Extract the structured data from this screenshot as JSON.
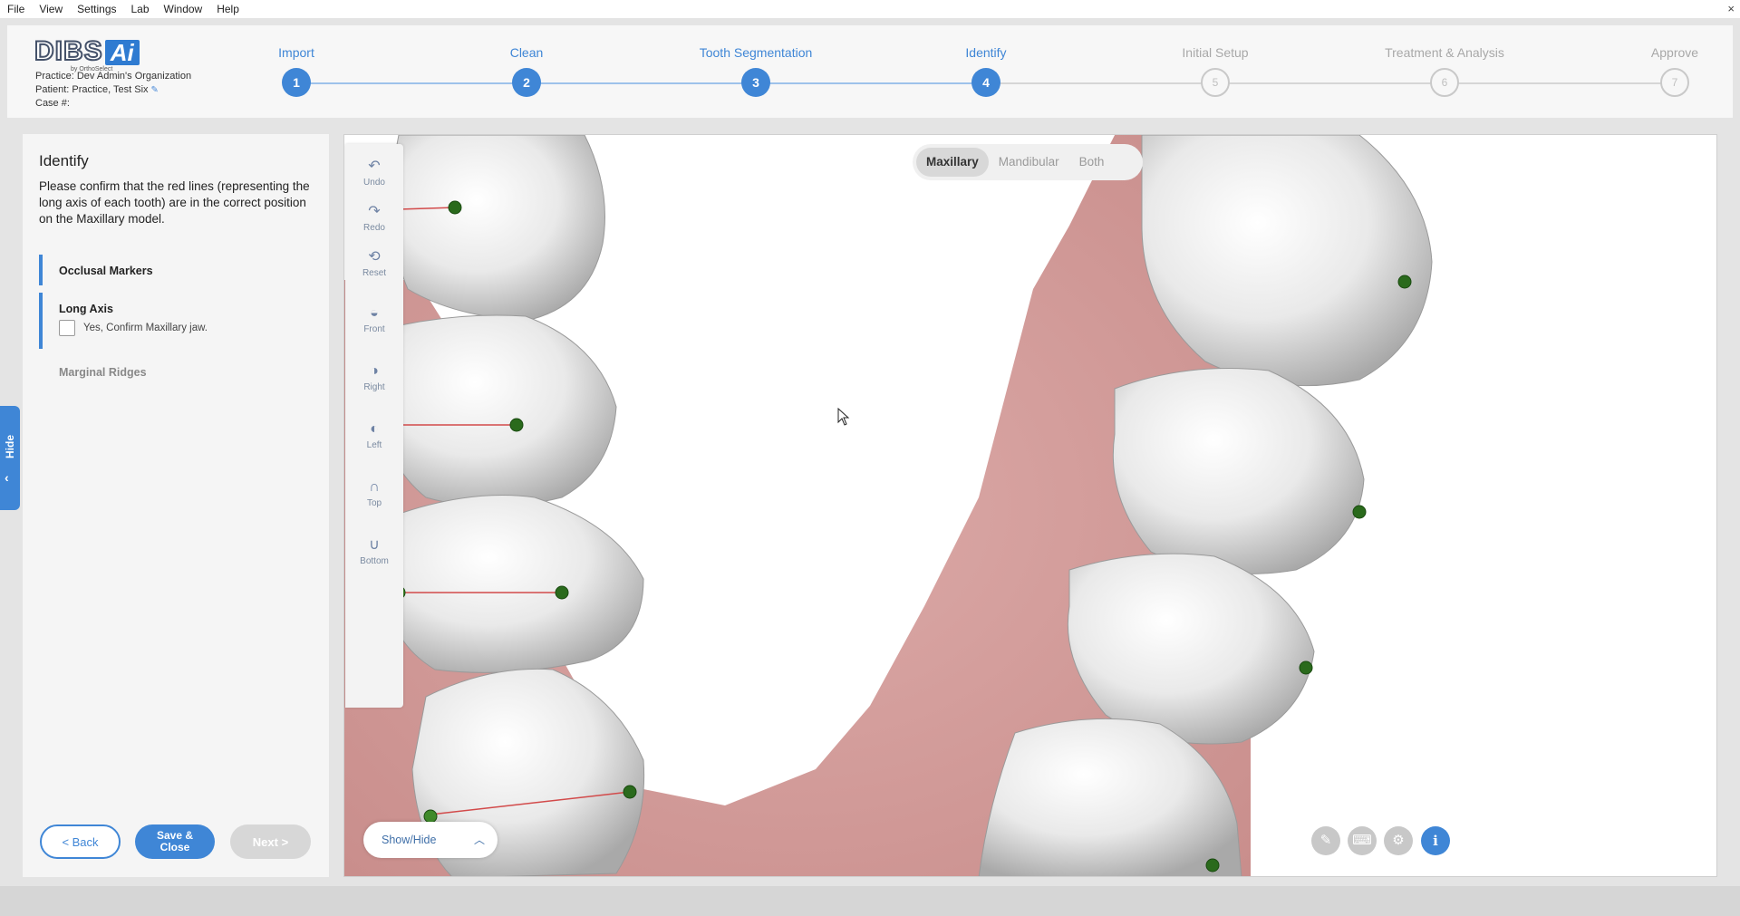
{
  "menu": [
    "File",
    "View",
    "Settings",
    "Lab",
    "Window",
    "Help"
  ],
  "window_close": "×",
  "header": {
    "logo_text": "DIBS",
    "logo_ai": "Ai",
    "logo_sub": "by OrthoSelect",
    "practice": "Practice: Dev Admin's Organization",
    "patient": "Patient: Practice, Test Six",
    "case": "Case #:"
  },
  "steps": [
    {
      "label": "Import",
      "number": "1",
      "state": "done"
    },
    {
      "label": "Clean",
      "number": "2",
      "state": "done"
    },
    {
      "label": "Tooth Segmentation",
      "number": "3",
      "state": "done"
    },
    {
      "label": "Identify",
      "number": "4",
      "state": "current"
    },
    {
      "label": "Initial Setup",
      "number": "5",
      "state": "pending"
    },
    {
      "label": "Treatment & Analysis",
      "number": "6",
      "state": "pending"
    },
    {
      "label": "Approve",
      "number": "7",
      "state": "pending"
    }
  ],
  "panel": {
    "title": "Identify",
    "instructions": "Please confirm that the red lines (representing the long axis of each tooth) are in the correct position on the Maxillary model.",
    "sections": {
      "occlusal": "Occlusal Markers",
      "long_axis": "Long Axis",
      "confirm_label": "Yes, Confirm Maxillary jaw.",
      "marginal": "Marginal Ridges"
    },
    "back": "<  Back",
    "save": "Save & Close",
    "next": "Next  >",
    "hide": "Hide"
  },
  "tools": [
    {
      "icon": "undo-icon",
      "glyph": "↶",
      "label": "Undo"
    },
    {
      "icon": "redo-icon",
      "glyph": "↷",
      "label": "Redo"
    },
    {
      "icon": "reset-icon",
      "glyph": "⟲",
      "label": "Reset"
    },
    {
      "icon": "front-view-icon",
      "glyph": "◒",
      "label": "Front"
    },
    {
      "icon": "right-view-icon",
      "glyph": "◑",
      "label": "Right"
    },
    {
      "icon": "left-view-icon",
      "glyph": "◐",
      "label": "Left"
    },
    {
      "icon": "top-view-icon",
      "glyph": "∩",
      "label": "Top"
    },
    {
      "icon": "bottom-view-icon",
      "glyph": "∪",
      "label": "Bottom"
    }
  ],
  "jaw": {
    "options": [
      "Maxillary",
      "Mandibular",
      "Both"
    ],
    "selected": "Maxillary"
  },
  "show_hide": "Show/Hide",
  "info_button": "i",
  "colors": {
    "accent": "#3f86d6",
    "gum": "#d9a4a2",
    "marker": "#2a6a1c"
  }
}
